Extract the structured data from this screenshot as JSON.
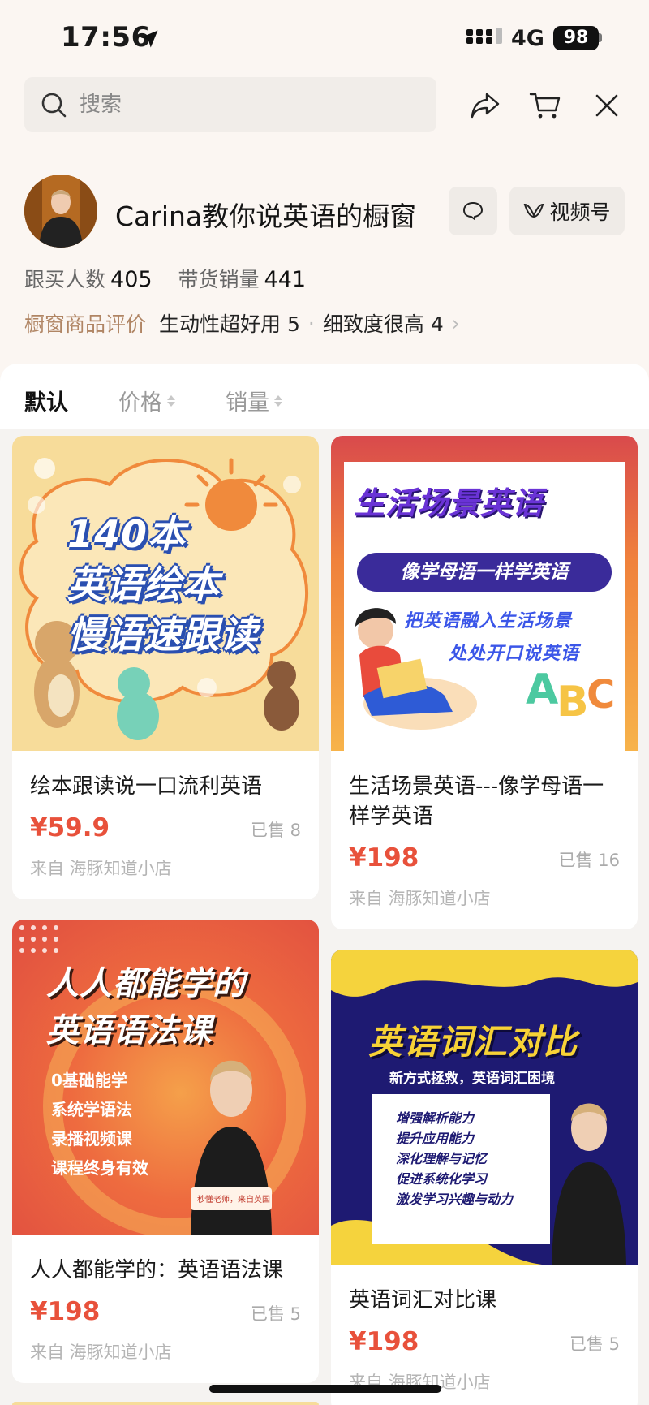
{
  "status_bar": {
    "time": "17:56",
    "network": "4G",
    "battery": "98"
  },
  "search": {
    "placeholder": "搜索"
  },
  "shop": {
    "name": "Carina教你说英语的橱窗",
    "video_label": "视频号",
    "followers_label": "跟买人数",
    "followers_value": "405",
    "sales_label": "带货销量",
    "sales_value": "441",
    "reviews_title": "橱窗商品评价",
    "reviews": [
      {
        "label": "生动性超好用",
        "count": "5"
      },
      {
        "label": "细致度很高",
        "count": "4"
      }
    ]
  },
  "sort_tabs": [
    {
      "label": "默认",
      "active": true
    },
    {
      "label": "价格"
    },
    {
      "label": "销量"
    }
  ],
  "products": [
    {
      "title": "绘本跟读说一口流利英语",
      "price": "¥59.9",
      "sold": "已售 8",
      "from": "来自 海豚知道小店",
      "thumb_lines": [
        "140本",
        "英语绘本",
        "慢语速跟读"
      ]
    },
    {
      "title": "生活场景英语---像学母语一样学英语",
      "price": "¥198",
      "sold": "已售 16",
      "from": "来自 海豚知道小店",
      "thumb_lines": [
        "生活场景英语",
        "像学母语一样学英语",
        "把英语融入生活场景",
        "处处开口说英语"
      ]
    },
    {
      "title": "人人都能学的：英语语法课",
      "price": "¥198",
      "sold": "已售 5",
      "from": "来自 海豚知道小店",
      "thumb_lines": [
        "人人都能学的",
        "英语语法课",
        "0基础能学",
        "系统学语法",
        "录播视频课",
        "课程终身有效",
        "秒懂老师，来自英国"
      ]
    },
    {
      "title": "英语词汇对比课",
      "price": "¥198",
      "sold": "已售 5",
      "from": "来自 海豚知道小店",
      "thumb_lines": [
        "英语词汇对比",
        "新方式拯救，英语词汇困境",
        "增强解析能力",
        "提升应用能力",
        "深化理解与记忆",
        "促进系统化学习",
        "激发学习兴趣与动力"
      ]
    }
  ]
}
